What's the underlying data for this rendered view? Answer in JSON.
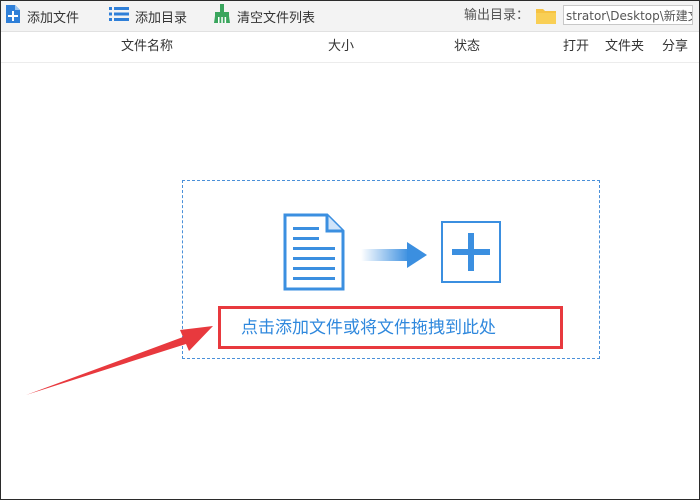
{
  "toolbar": {
    "add_file_label": "添加文件",
    "add_folder_label": "添加目录",
    "clear_list_label": "清空文件列表",
    "output_dir_label": "输出目录：",
    "output_dir_value": "strator\\Desktop\\新建文"
  },
  "columns": {
    "name": "文件名称",
    "size": "大小",
    "status": "状态",
    "open": "打开",
    "folder": "文件夹",
    "share": "分享"
  },
  "dropzone": {
    "hint": "点击添加文件或将文件拖拽到此处"
  },
  "icons": {
    "add_file": "add-file-icon",
    "add_folder": "list-icon",
    "clear_list": "broom-icon",
    "output_folder": "folder-icon",
    "document": "document-icon",
    "arrow": "arrow-right-icon",
    "plus": "plus-icon"
  },
  "colors": {
    "accent_blue": "#2f88dd",
    "highlight_red": "#e8393e",
    "folder_yellow": "#f6c343",
    "broom_green": "#3aa55d"
  }
}
